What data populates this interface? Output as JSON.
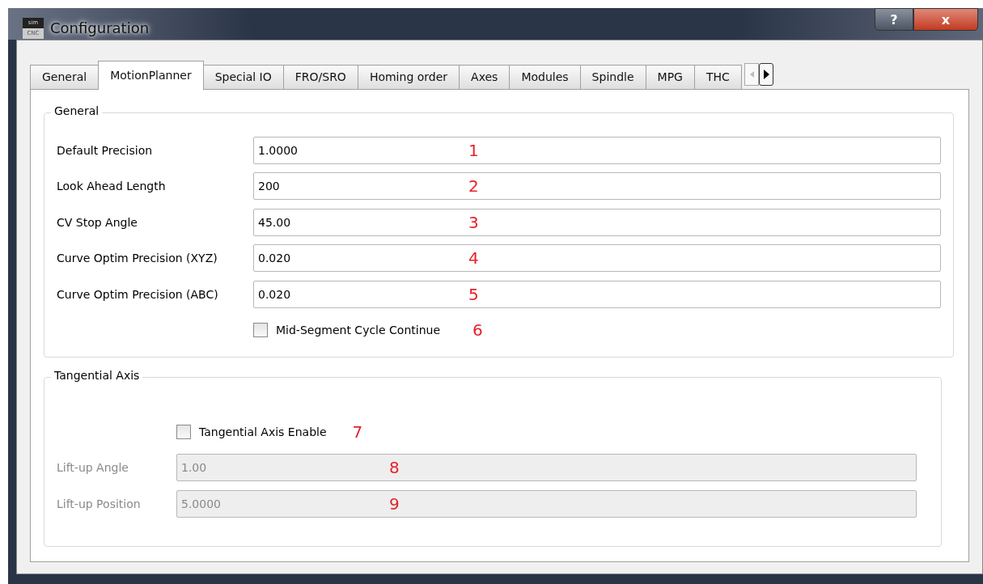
{
  "window": {
    "title": "Configuration",
    "logo_top": "sim",
    "logo_bottom": "CNC",
    "help": "?",
    "close": "x"
  },
  "tabs": [
    {
      "label": "General",
      "selected": false
    },
    {
      "label": "MotionPlanner",
      "selected": true
    },
    {
      "label": "Special IO",
      "selected": false
    },
    {
      "label": "FRO/SRO",
      "selected": false
    },
    {
      "label": "Homing order",
      "selected": false
    },
    {
      "label": "Axes",
      "selected": false
    },
    {
      "label": "Modules",
      "selected": false
    },
    {
      "label": "Spindle",
      "selected": false
    },
    {
      "label": "MPG",
      "selected": false
    },
    {
      "label": "THC",
      "selected": false
    }
  ],
  "groups": [
    {
      "title": "General",
      "items": [
        {
          "kind": "field",
          "label": "Default Precision",
          "value": "1.0000",
          "disabled": false,
          "annotation": "1"
        },
        {
          "kind": "field",
          "label": "Look Ahead Length",
          "value": "200",
          "disabled": false,
          "annotation": "2"
        },
        {
          "kind": "field",
          "label": "CV Stop Angle",
          "value": "45.00",
          "disabled": false,
          "annotation": "3"
        },
        {
          "kind": "field",
          "label": "Curve Optim Precision (XYZ)",
          "value": "0.020",
          "disabled": false,
          "annotation": "4"
        },
        {
          "kind": "field",
          "label": "Curve Optim Precision (ABC)",
          "value": "0.020",
          "disabled": false,
          "annotation": "5"
        },
        {
          "kind": "checkbox",
          "label": "Mid-Segment Cycle Continue",
          "checked": false,
          "annotation": "6"
        }
      ]
    },
    {
      "title": "Tangential Axis",
      "items": [
        {
          "kind": "checkbox",
          "label": "Tangential Axis Enable",
          "checked": false,
          "annotation": "7"
        },
        {
          "kind": "field",
          "label": "Lift-up Angle",
          "value": "1.00",
          "disabled": true,
          "annotation": "8"
        },
        {
          "kind": "field",
          "label": "Lift-up Position",
          "value": "5.0000",
          "disabled": true,
          "annotation": "9"
        }
      ]
    }
  ]
}
